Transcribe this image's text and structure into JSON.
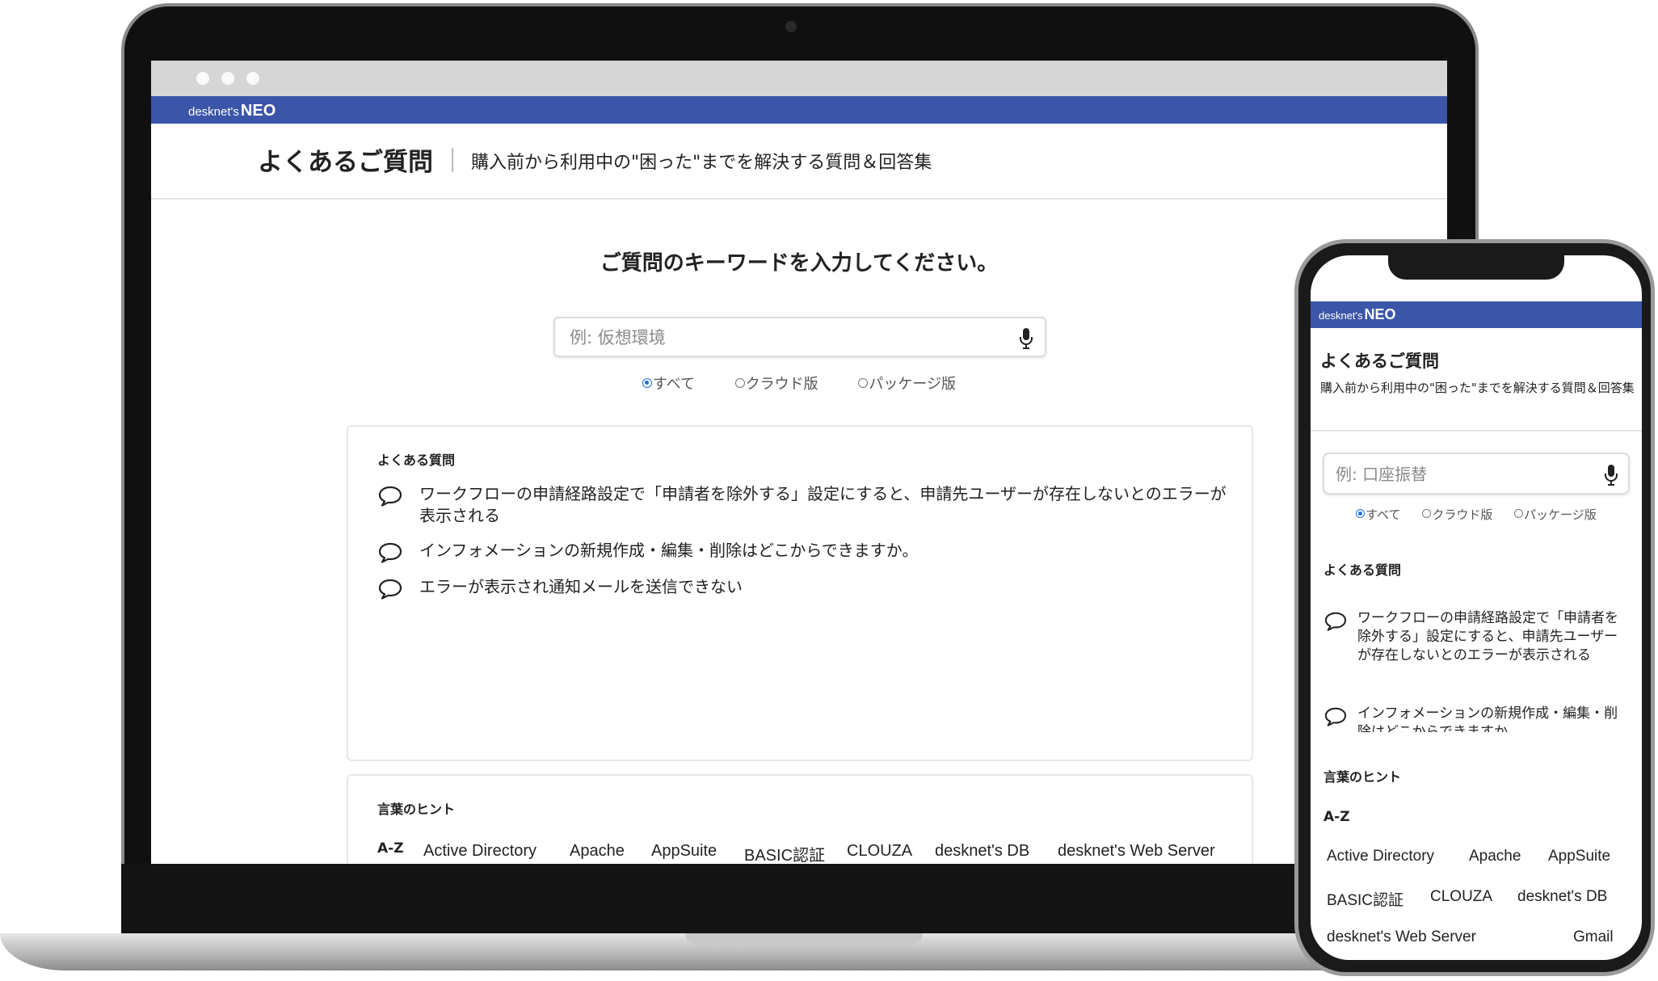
{
  "brand": {
    "name": "desknet's",
    "product": "NEO"
  },
  "laptop": {
    "header": {
      "title": "よくあるご質問",
      "subtitle": "購入前から利用中の\"困った\"までを解決する質問＆回答集"
    },
    "search": {
      "prompt": "ご質問のキーワードを入力してください。",
      "placeholder": "例: 仮想環境"
    },
    "filters": [
      {
        "label": "すべて",
        "selected": true
      },
      {
        "label": "クラウド版",
        "selected": false
      },
      {
        "label": "パッケージ版",
        "selected": false
      }
    ],
    "faq": {
      "title": "よくある質問",
      "items": [
        "ワークフローの申請経路設定で「申請者を除外する」設定にすると、申請先ユーザーが存在しないとのエラーが表示される",
        "インフォメーションの新規作成・編集・削除はどこからできますか。",
        "エラーが表示され通知メールを送信できない"
      ]
    },
    "hints": {
      "title": "言葉のヒント",
      "group": "A-Z",
      "keywords": [
        "Active Directory",
        "Apache",
        "AppSuite",
        "BASIC認証",
        "CLOUZA",
        "desknet's DB",
        "desknet's Web Server"
      ]
    }
  },
  "phone": {
    "header": {
      "title": "よくあるご質問",
      "subtitle": "購入前から利用中の\"困った\"までを解決する質問＆回答集"
    },
    "search": {
      "placeholder": "例: 口座振替"
    },
    "filters": [
      {
        "label": "すべて",
        "selected": true
      },
      {
        "label": "クラウド版",
        "selected": false
      },
      {
        "label": "パッケージ版",
        "selected": false
      }
    ],
    "faq": {
      "title": "よくある質問",
      "items": [
        "ワークフローの申請経路設定で「申請者を除外する」設定にすると、申請先ユーザーが存在しないとのエラーが表示される",
        "インフォメーションの新規作成・編集・削除はどこからできますか。"
      ]
    },
    "hints": {
      "title": "言葉のヒント",
      "group": "A-Z",
      "keywords": [
        "Active Directory",
        "Apache",
        "AppSuite",
        "BASIC認証",
        "CLOUZA",
        "desknet's DB",
        "desknet's Web Server",
        "Gmail"
      ]
    }
  },
  "colors": {
    "brand_bar": "#3b55a8",
    "radio_selected": "#1f6fe0"
  },
  "icons": {
    "faq_item": "speech-bubble-icon",
    "search_voice": "microphone-icon"
  }
}
